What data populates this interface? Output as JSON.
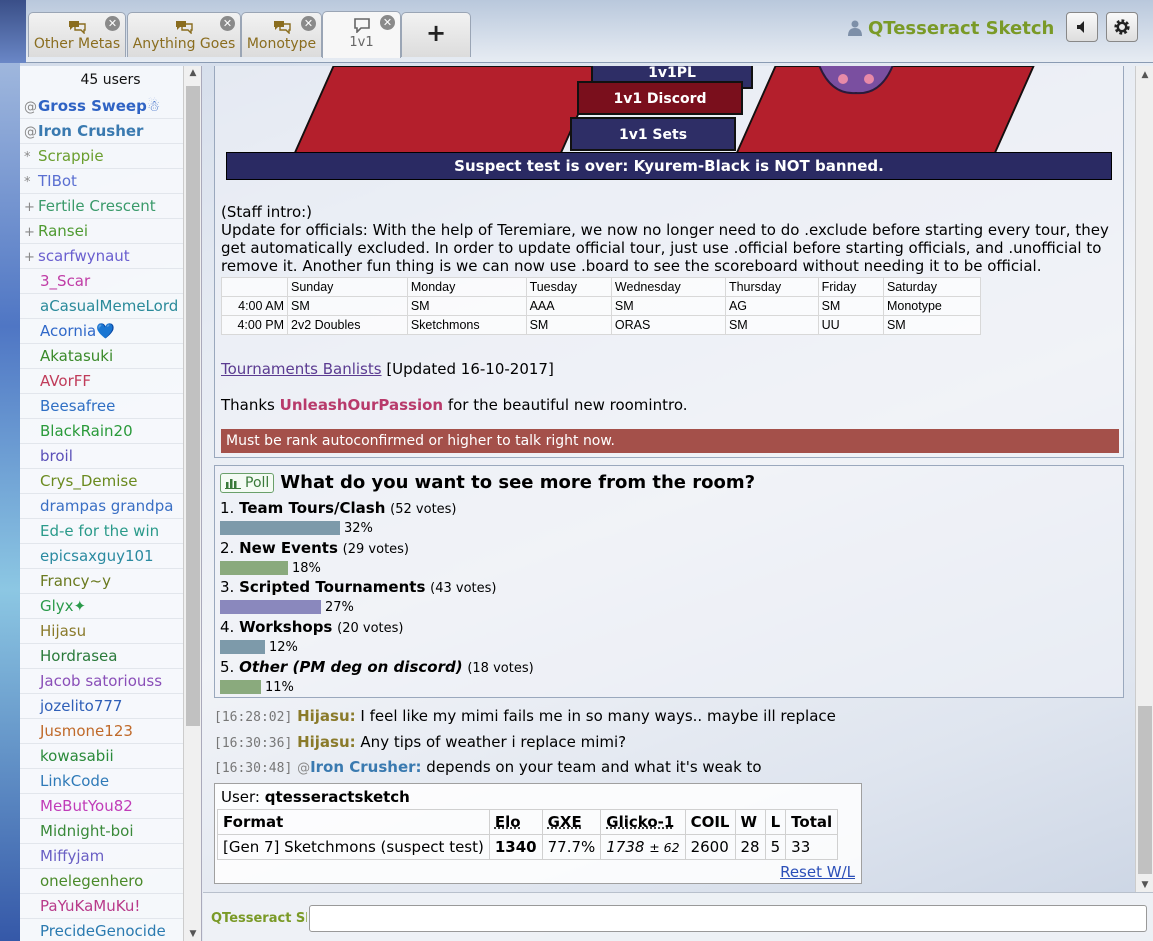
{
  "tabs": [
    {
      "label": "Other Metas",
      "active": false
    },
    {
      "label": "Anything Goes",
      "active": false
    },
    {
      "label": "Monotype",
      "active": false
    },
    {
      "label": "1v1",
      "active": true
    }
  ],
  "new_tab_label": "+",
  "header": {
    "username": "QTesseract Sketch"
  },
  "userlist": {
    "count": "45 users",
    "users": [
      {
        "rank": "@",
        "name": "Gross Sweep",
        "suffix": "☃",
        "color": "#2f63c4",
        "staff": true
      },
      {
        "rank": "@",
        "name": "Iron Crusher",
        "suffix": "",
        "color": "#3a7ab0",
        "staff": true
      },
      {
        "rank": "*",
        "name": "Scrappie",
        "suffix": "",
        "color": "#6a9e2e",
        "staff": false
      },
      {
        "rank": "*",
        "name": "TIBot",
        "suffix": "",
        "color": "#5a6fd1",
        "staff": false
      },
      {
        "rank": "+",
        "name": "Fertile Crescent",
        "suffix": "",
        "color": "#3a9a6a",
        "staff": false
      },
      {
        "rank": "+",
        "name": "Ransei",
        "suffix": "",
        "color": "#4f9a31",
        "staff": false
      },
      {
        "rank": "+",
        "name": "scarfwynaut",
        "suffix": "",
        "color": "#6a5fcf",
        "staff": false
      },
      {
        "rank": "",
        "name": "3_Scar",
        "suffix": "",
        "color": "#c03ca6",
        "staff": false
      },
      {
        "rank": "",
        "name": "aCasualMemeLord",
        "suffix": "",
        "color": "#2a8a9a",
        "staff": false
      },
      {
        "rank": "",
        "name": "Acornia",
        "suffix": "💙",
        "color": "#2f68c9",
        "staff": false
      },
      {
        "rank": "",
        "name": "Akatasuki",
        "suffix": "",
        "color": "#3a8a2a",
        "staff": false
      },
      {
        "rank": "",
        "name": "AVorFF",
        "suffix": "",
        "color": "#c03c5a",
        "staff": false
      },
      {
        "rank": "",
        "name": "Beesafree",
        "suffix": "",
        "color": "#2f6fc4",
        "staff": false
      },
      {
        "rank": "",
        "name": "BlackRain20",
        "suffix": "",
        "color": "#2a9a3a",
        "staff": false
      },
      {
        "rank": "",
        "name": "broil",
        "suffix": "",
        "color": "#5a4fb8",
        "staff": false
      },
      {
        "rank": "",
        "name": "Crys_Demise",
        "suffix": "",
        "color": "#6a8a1f",
        "staff": false
      },
      {
        "rank": "",
        "name": "drampas grandpa",
        "suffix": "",
        "color": "#3a6fc4",
        "staff": false
      },
      {
        "rank": "",
        "name": "Ed-e for the win",
        "suffix": "",
        "color": "#2a9a8a",
        "staff": false
      },
      {
        "rank": "",
        "name": "epicsaxguy101",
        "suffix": "",
        "color": "#2a8aa0",
        "staff": false
      },
      {
        "rank": "",
        "name": "Francy~y",
        "suffix": "",
        "color": "#6a7a1f",
        "staff": false
      },
      {
        "rank": "",
        "name": "Glyx",
        "suffix": "✦",
        "color": "#2a9a4a",
        "staff": false
      },
      {
        "rank": "",
        "name": "Hijasu",
        "suffix": "",
        "color": "#8a7a2a",
        "staff": false
      },
      {
        "rank": "",
        "name": "Hordrasea",
        "suffix": "",
        "color": "#2a7a3a",
        "staff": false
      },
      {
        "rank": "",
        "name": "Jacob satoriouss",
        "suffix": "",
        "color": "#8a4fb8",
        "staff": false
      },
      {
        "rank": "",
        "name": "jozelito777",
        "suffix": "",
        "color": "#2f5fb8",
        "staff": false
      },
      {
        "rank": "",
        "name": "Jusmone123",
        "suffix": "",
        "color": "#c06a2a",
        "staff": false
      },
      {
        "rank": "",
        "name": "kowasabii",
        "suffix": "",
        "color": "#2a8a3a",
        "staff": false
      },
      {
        "rank": "",
        "name": "LinkCode",
        "suffix": "",
        "color": "#2f7ab8",
        "staff": false
      },
      {
        "rank": "",
        "name": "MeButYou82",
        "suffix": "",
        "color": "#c03cb8",
        "staff": false
      },
      {
        "rank": "",
        "name": "Midnight-boi",
        "suffix": "",
        "color": "#3a8a3a",
        "staff": false
      },
      {
        "rank": "",
        "name": "Miffyjam",
        "suffix": "",
        "color": "#6a5fc4",
        "staff": false
      },
      {
        "rank": "",
        "name": "onelegenhero",
        "suffix": "",
        "color": "#4a8a2a",
        "staff": false
      },
      {
        "rank": "",
        "name": "PaYuKaMuKu!",
        "suffix": "",
        "color": "#b83a8a",
        "staff": false
      },
      {
        "rank": "",
        "name": "PrecideGenocide",
        "suffix": "",
        "color": "#2a7ab0",
        "staff": false
      }
    ]
  },
  "intro": {
    "banner_buttons": [
      "1v1PL",
      "1v1 Discord",
      "1v1 Sets"
    ],
    "suspect": "Suspect test is over: Kyurem-Black is NOT banned.",
    "staff_intro": "(Staff intro:)",
    "update_text": "Update for officials: With the help of Teremiare, we now no longer need to do .exclude before starting every tour, they get automatically excluded. In order to update official tour, just use .official before starting officials, and .unofficial to remove it. Another fun thing is we can now use .board to see the scoreboard without needing it to be official.",
    "schedule": {
      "days": [
        "",
        "Sunday",
        "Monday",
        "Tuesday",
        "Wednesday",
        "Thursday",
        "Friday",
        "Saturday"
      ],
      "rows": [
        [
          "4:00 AM",
          "SM",
          "SM",
          "AAA",
          "SM",
          "AG",
          "SM",
          "Monotype"
        ],
        [
          "4:00 PM",
          "2v2 Doubles",
          "Sketchmons",
          "SM",
          "ORAS",
          "SM",
          "UU",
          "SM"
        ]
      ]
    },
    "banlist_link": "Tournaments Banlists",
    "banlist_suffix": " [Updated 16-10-2017]",
    "thanks_pre": "Thanks ",
    "thanks_user": "UnleashOurPassion",
    "thanks_post": " for the beautiful new roomintro.",
    "rank_notice": "Must be rank autoconfirmed or higher to talk right now."
  },
  "poll": {
    "tag": "Poll",
    "question": "What do you want to see more from the room?",
    "options": [
      {
        "num": "1.",
        "label": "Team Tours/Clash",
        "votes": "(52 votes)",
        "pct": "32%",
        "value": 32,
        "color": "#7d9aaa",
        "italic": false
      },
      {
        "num": "2.",
        "label": "New Events",
        "votes": "(29 votes)",
        "pct": "18%",
        "value": 18,
        "color": "#8aaa7d",
        "italic": false
      },
      {
        "num": "3.",
        "label": "Scripted Tournaments",
        "votes": "(43 votes)",
        "pct": "27%",
        "value": 27,
        "color": "#8a88bd",
        "italic": false
      },
      {
        "num": "4.",
        "label": "Workshops",
        "votes": "(20 votes)",
        "pct": "12%",
        "value": 12,
        "color": "#7d9aaa",
        "italic": false
      },
      {
        "num": "5.",
        "label": "Other (PM deg on discord)",
        "votes": "(18 votes)",
        "pct": "11%",
        "value": 11,
        "color": "#8aaa7d",
        "italic": true
      }
    ]
  },
  "messages": [
    {
      "time": "[16:28:02]",
      "rank": "",
      "author": "Hijasu:",
      "color": "#8a7a2a",
      "text": "I feel like my mimi fails me in so many ways.. maybe ill replace"
    },
    {
      "time": "[16:30:36]",
      "rank": "",
      "author": "Hijasu:",
      "color": "#8a7a2a",
      "text": "Any tips of weather i replace mimi?"
    },
    {
      "time": "[16:30:48]",
      "rank": "@",
      "author": "Iron Crusher:",
      "color": "#3a7ab0",
      "text": "depends on your team and what it's weak to"
    }
  ],
  "ladder": {
    "user_label": "User: ",
    "user": "qtesseractsketch",
    "headers": [
      "Format",
      "Elo",
      "GXE",
      "Glicko-1",
      "COIL",
      "W",
      "L",
      "Total"
    ],
    "row": {
      "format": "[Gen 7] Sketchmons (suspect test)",
      "elo": "1340",
      "gxe": "77.7%",
      "glicko": "1738",
      "glicko_dev": "± 62",
      "coil": "2600",
      "w": "28",
      "l": "5",
      "total": "33"
    },
    "reset": "Reset W/L"
  },
  "compose": {
    "name": "QTesseract Sketch",
    "value": "",
    "placeholder": ""
  }
}
